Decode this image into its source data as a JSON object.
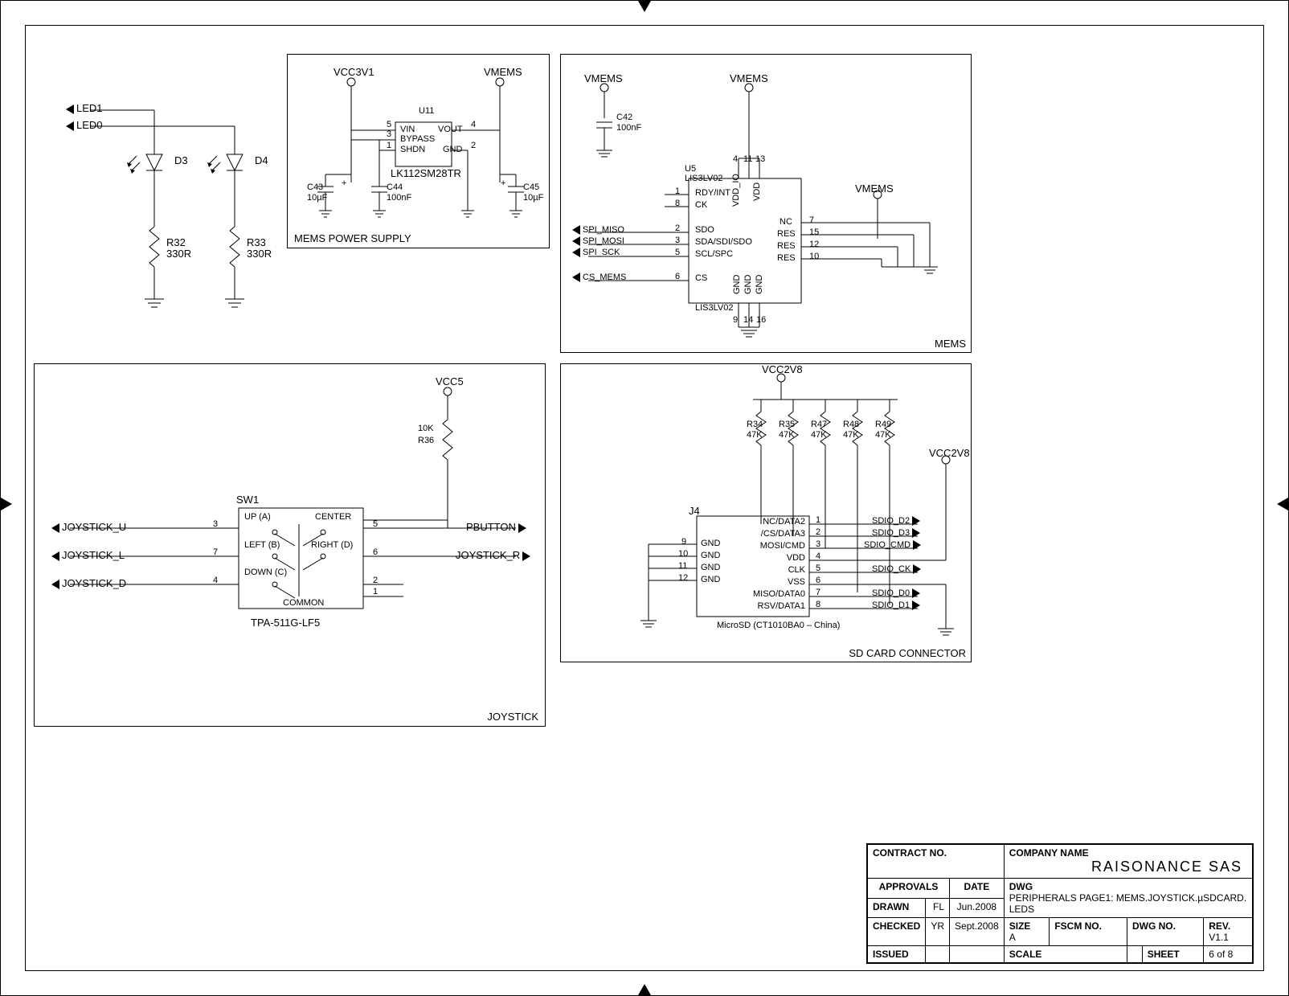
{
  "leds_block": {
    "net_led1": "LED1",
    "net_led0": "LED0",
    "d3": "D3",
    "d4": "D4",
    "r32_ref": "R32",
    "r32_val": "330R",
    "r33_ref": "R33",
    "r33_val": "330R"
  },
  "mems_ps": {
    "title": "MEMS POWER SUPPLY",
    "vcc3v1": "VCC3V1",
    "vmems": "VMEMS",
    "u11_ref": "U11",
    "u11_part": "LK112SM28TR",
    "pin_vin": "VIN",
    "pin_vout": "VOUT",
    "pin_bypass": "BYPASS",
    "pin_shdn": "SHDN",
    "pin_gnd": "GND",
    "pin5": "5",
    "pin3": "3",
    "pin1": "1",
    "pin4": "4",
    "pin2": "2",
    "c43_ref": "C43",
    "c43_val": "10µF",
    "c44_ref": "C44",
    "c44_val": "100nF",
    "c45_ref": "C45",
    "c45_val": "10µF"
  },
  "mems": {
    "title": "MEMS",
    "vmems1": "VMEMS",
    "vmems2": "VMEMS",
    "vmems3": "VMEMS",
    "c42_ref": "C42",
    "c42_val": "100nF",
    "u5_ref": "U5",
    "u5_part_top": "LIS3LV02",
    "u5_part_bot": "LIS3LV02",
    "pins_left": {
      "rdy": "RDY/INT",
      "ck": "CK",
      "sdo": "SDO",
      "sda": "SDA/SDI/SDO",
      "scl": "SCL/SPC",
      "cs": "CS"
    },
    "pins_left_num": {
      "rdy": "1",
      "ck": "8",
      "sdo": "2",
      "sda": "3",
      "scl": "5",
      "cs": "6"
    },
    "pins_top": {
      "vddio": "VDD_IO",
      "vdd": "VDD"
    },
    "pins_top_num": {
      "p4": "4",
      "p11": "11",
      "p13": "13"
    },
    "pins_right": {
      "nc": "NC",
      "res1": "RES",
      "res2": "RES",
      "res3": "RES"
    },
    "pins_right_num": {
      "nc": "7",
      "res1": "15",
      "res2": "12",
      "res3": "10"
    },
    "pins_bot": {
      "gnd": "GND"
    },
    "pins_bot_num": {
      "p9": "9",
      "p14": "14",
      "p16": "16"
    },
    "net_spi_miso": "SPI_MISO",
    "net_spi_mosi": "SPI_MOSI",
    "net_spi_sck": "SPI_SCK",
    "net_cs_mems": "CS_MEMS"
  },
  "joystick": {
    "title": "JOYSTICK",
    "vcc5": "VCC5",
    "r36_ref": "R36",
    "r36_val": "10K",
    "sw1_ref": "SW1",
    "sw1_part": "TPA-511G-LF5",
    "labels": {
      "up": "UP (A)",
      "left": "LEFT (B)",
      "down": "DOWN (C)",
      "right": "RIGHT (D)",
      "center": "CENTER",
      "common": "COMMON"
    },
    "pin_nums": {
      "up": "3",
      "left": "7",
      "down": "4",
      "center": "5",
      "right": "6",
      "com2": "2",
      "com1": "1"
    },
    "net_u": "JOYSTICK_U",
    "net_l": "JOYSTICK_L",
    "net_d": "JOYSTICK_D",
    "net_pbutton": "PBUTTON",
    "net_r": "JOYSTICK_R"
  },
  "sdcard": {
    "title": "SD CARD CONNECTOR",
    "vcc2v8_top": "VCC2V8",
    "vcc2v8_right": "VCC2V8",
    "r34": {
      "ref": "R34",
      "val": "47K"
    },
    "r35": {
      "ref": "R35",
      "val": "47K"
    },
    "r47": {
      "ref": "R47",
      "val": "47K"
    },
    "r48": {
      "ref": "R48",
      "val": "47K"
    },
    "r49": {
      "ref": "R49",
      "val": "47K"
    },
    "j4_ref": "J4",
    "j4_part": "MicroSD (CT1010BA0 – China)",
    "j4_left_pins": {
      "nc": "NC/DATA2",
      "cs": "/CS/DATA3",
      "mosi": "MOSI/CMD",
      "vdd": "VDD",
      "clk": "CLK",
      "vss": "VSS",
      "miso": "MISO/DATA0",
      "rsv": "RSV/DATA1"
    },
    "j4_left_nums": {
      "1": "1",
      "2": "2",
      "3": "3",
      "4": "4",
      "5": "5",
      "6": "6",
      "7": "7",
      "8": "8"
    },
    "j4_right_gnd_nums": {
      "9": "9",
      "10": "10",
      "11": "11",
      "12": "12"
    },
    "j4_right_gnd": "GND",
    "net_d2": "SDIO_D2",
    "net_d3": "SDIO_D3",
    "net_cmd": "SDIO_CMD",
    "net_ck": "SDIO_CK",
    "net_d0": "SDIO_D0",
    "net_d1": "SDIO_D1"
  },
  "titleblock": {
    "contract_no": "CONTRACT NO.",
    "company_name_lbl": "COMPANY NAME",
    "company_name": "RAISONANCE SAS",
    "approvals": "APPROVALS",
    "date": "DATE",
    "dwg": "DWG",
    "dwg_desc": "PERIPHERALS PAGE1:   MEMS.JOYSTICK.µSDCARD. LEDS",
    "drawn": "DRAWN",
    "drawn_by": "FL",
    "drawn_date": "Jun.2008",
    "checked": "CHECKED",
    "checked_by": "YR",
    "checked_date": "Sept.2008",
    "issued": "ISSUED",
    "size": "SIZE",
    "size_val": "A",
    "fscm": "FSCM NO.",
    "dwg_no": "DWG NO.",
    "rev": "REV.",
    "rev_val": "V1.1",
    "scale": "SCALE",
    "sheet": "SHEET",
    "sheet_val": "6 of 8"
  }
}
